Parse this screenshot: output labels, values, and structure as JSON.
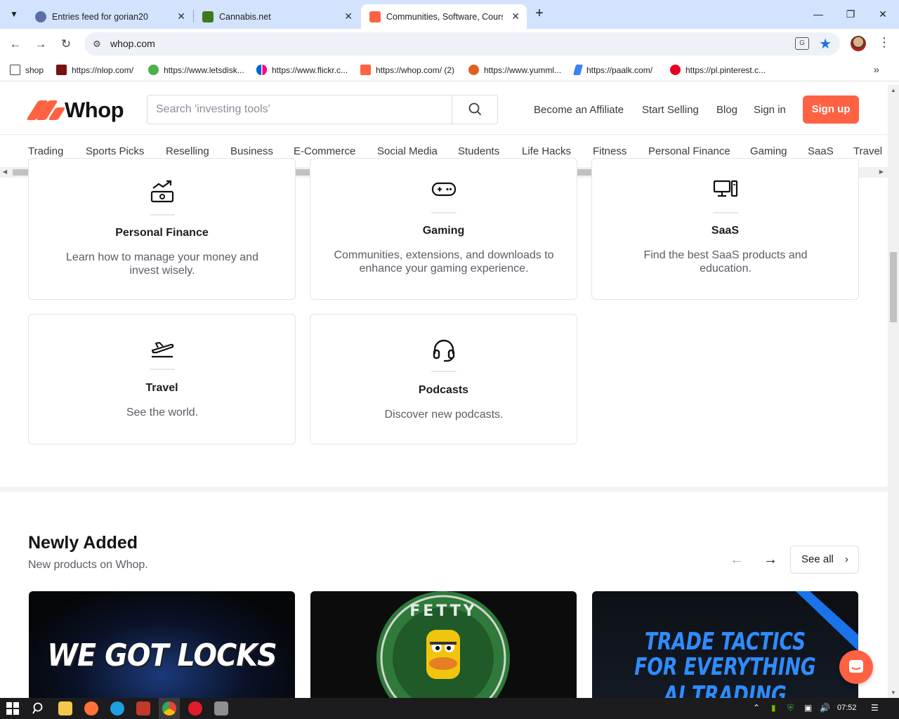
{
  "browser": {
    "tabs": [
      {
        "title": "Entries feed for gorian20",
        "active": false
      },
      {
        "title": "Cannabis.net",
        "active": false
      },
      {
        "title": "Communities, Software, Courses",
        "active": true
      }
    ],
    "url": "whop.com",
    "bookmarks": [
      "shop",
      "https://nlop.com/",
      "https://www.letsdisk...",
      "https://www.flickr.c...",
      "https://whop.com/ (2)",
      "https://www.yumml...",
      "https://paalk.com/",
      "https://pl.pinterest.c..."
    ]
  },
  "header": {
    "logo_text": "Whop",
    "search_placeholder": "Search 'investing tools'",
    "links": [
      "Become an Affiliate",
      "Start Selling",
      "Blog",
      "Sign in"
    ],
    "signup_label": "Sign up"
  },
  "categories": [
    "Trading",
    "Sports Picks",
    "Reselling",
    "Business",
    "E-Commerce",
    "Social Media",
    "Students",
    "Life Hacks",
    "Fitness",
    "Personal Finance",
    "Gaming",
    "SaaS",
    "Travel"
  ],
  "cards": [
    {
      "icon": "money-growth-icon",
      "title": "Personal Finance",
      "description": "Learn how to manage your money and invest wisely."
    },
    {
      "icon": "gamepad-icon",
      "title": "Gaming",
      "description": "Communities, extensions, and downloads to enhance your gaming experience."
    },
    {
      "icon": "desktop-computer-icon",
      "title": "SaaS",
      "description": "Find the best SaaS products and education."
    },
    {
      "icon": "airplane-takeoff-icon",
      "title": "Travel",
      "description": "See the world."
    },
    {
      "icon": "headphones-icon",
      "title": "Podcasts",
      "description": "Discover new podcasts."
    }
  ],
  "newly_added": {
    "title": "Newly Added",
    "subtitle": "New products on Whop.",
    "see_all_label": "See all",
    "products": [
      {
        "image_text": "WE GOT LOCKS"
      },
      {
        "image_text": "FETTY"
      },
      {
        "image_text_line1": "TRADE TACTICS",
        "image_text_line2": "FOR EVERYTHING AI TRADING"
      }
    ]
  },
  "taskbar": {
    "time": "07:52"
  },
  "colors": {
    "brand": "#ff6243",
    "tabstrip": "#d3e3fd",
    "bookmark_star": "#1a73e8"
  }
}
